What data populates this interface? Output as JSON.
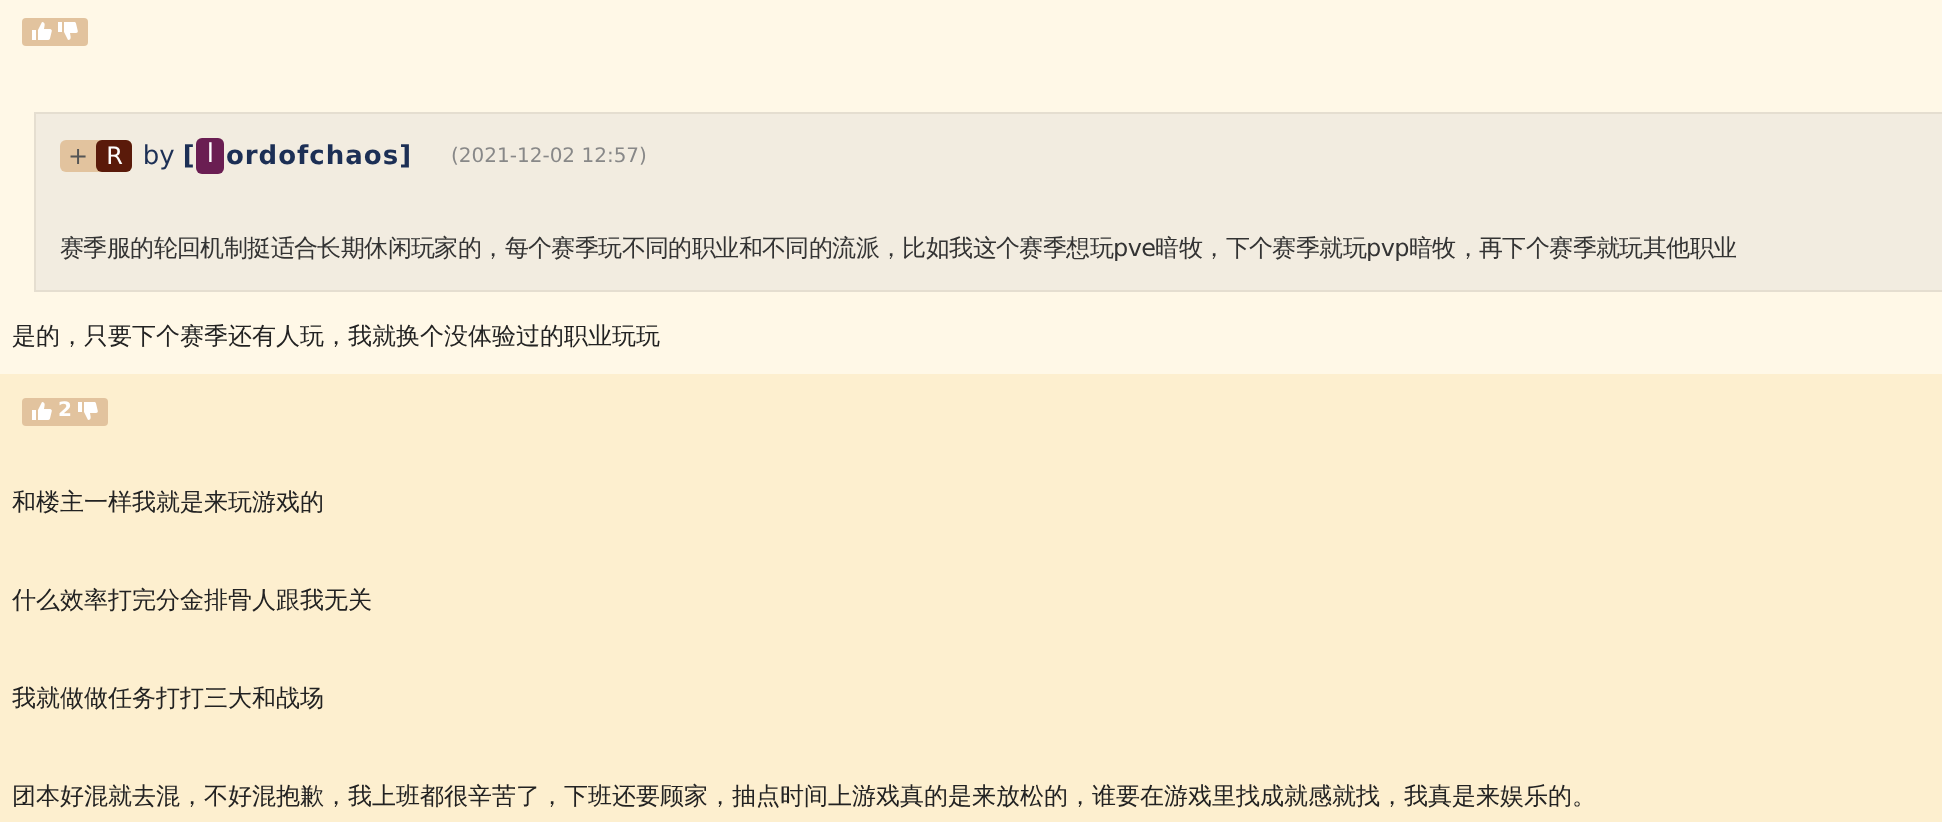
{
  "posts": [
    {
      "quote": {
        "rank_plus": "+",
        "rank": "R",
        "by": "by",
        "bracket_open": "[",
        "user_initial": "l",
        "user_rest": "ordofchaos",
        "bracket_close": "]",
        "time": "(2021-12-02 12:57)",
        "text": "赛季服的轮回机制挺适合长期休闲玩家的，每个赛季玩不同的职业和不同的流派，比如我这个赛季想玩pve暗牧，下个赛季就玩pvp暗牧，再下个赛季就玩其他职业"
      },
      "paragraphs": [
        "是的，只要下个赛季还有人玩，我就换个没体验过的职业玩玩"
      ]
    },
    {
      "votes": {
        "count": "2"
      },
      "paragraphs": [
        "和楼主一样我就是来玩游戏的",
        "什么效率打完分金排骨人跟我无关",
        "我就做做任务打打三大和战场",
        "团本好混就去混，不好混抱歉，我上班都很辛苦了，下班还要顾家，抽点时间上游戏真的是来放松的，谁要在游戏里找成就感就找，我真是来娱乐的。"
      ]
    }
  ]
}
